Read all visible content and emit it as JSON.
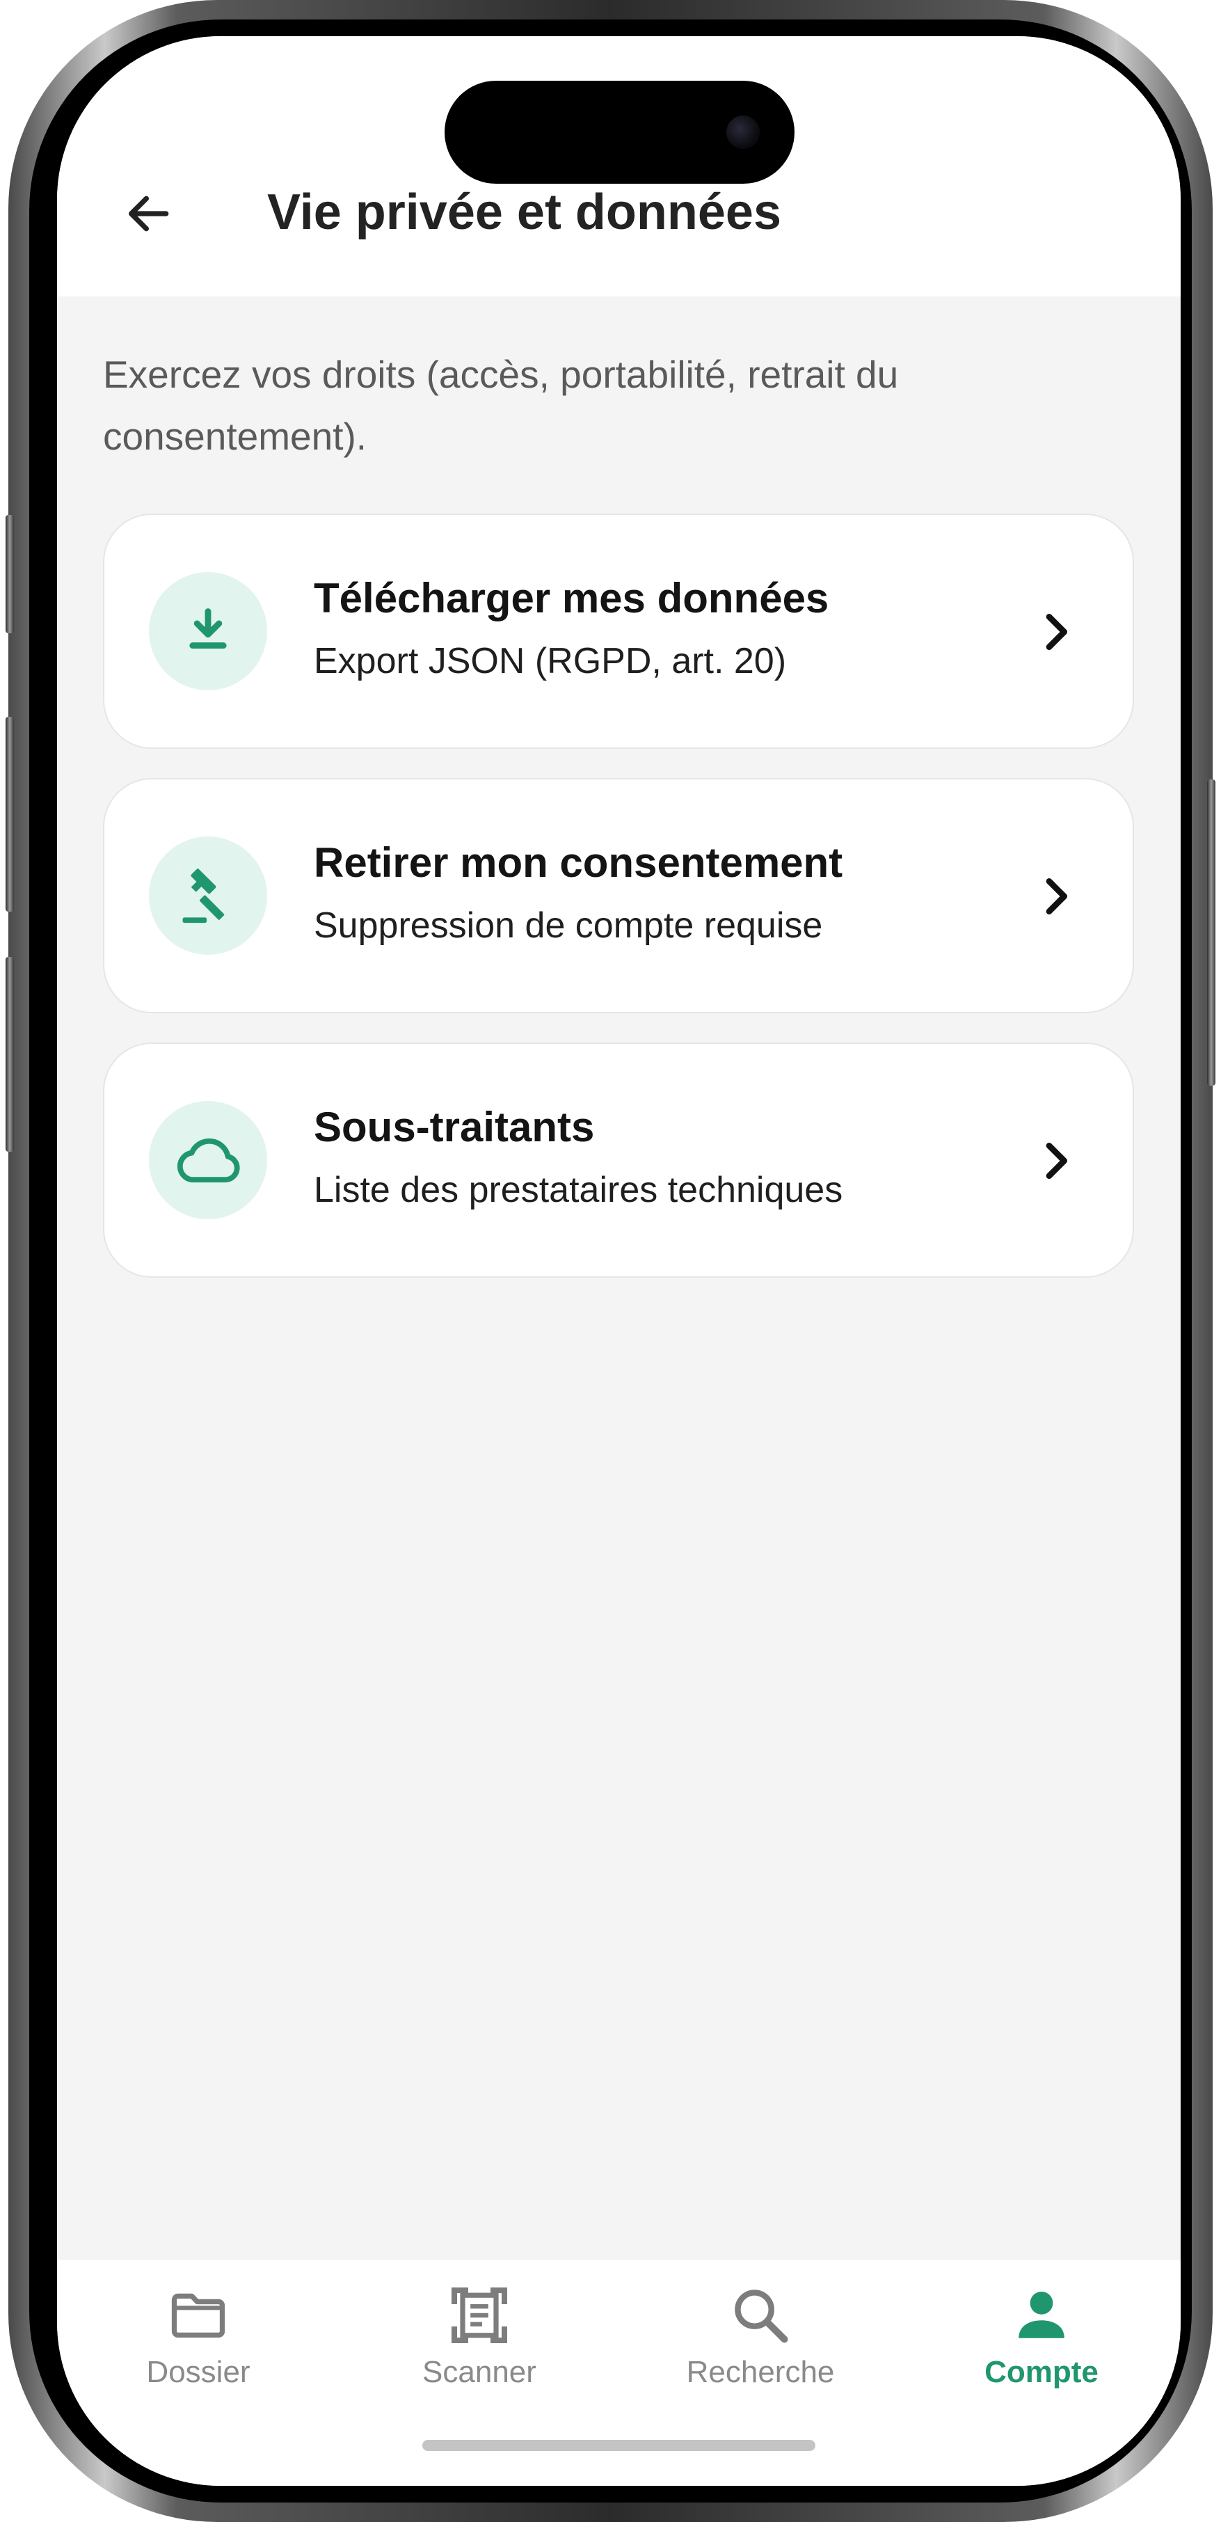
{
  "header": {
    "title": "Vie privée et données",
    "back_icon": "arrow-left-icon"
  },
  "intro": "Exercez vos droits (accès, portabilité, retrait du consentement).",
  "cards": [
    {
      "icon": "download-icon",
      "title": "Télécharger mes données",
      "subtitle": "Export JSON (RGPD, art. 20)"
    },
    {
      "icon": "gavel-icon",
      "title": "Retirer mon consentement",
      "subtitle": "Suppression de compte requise"
    },
    {
      "icon": "cloud-icon",
      "title": "Sous-traitants",
      "subtitle": "Liste des prestataires techniques"
    }
  ],
  "bottom_nav": {
    "items": [
      {
        "label": "Dossier",
        "icon": "folder-icon",
        "active": false
      },
      {
        "label": "Scanner",
        "icon": "document-scanner-icon",
        "active": false
      },
      {
        "label": "Recherche",
        "icon": "search-icon",
        "active": false
      },
      {
        "label": "Compte",
        "icon": "person-icon",
        "active": true
      }
    ]
  },
  "colors": {
    "accent": "#20966f",
    "icon_bg": "#e2f4ee",
    "background": "#f4f4f4",
    "nav_inactive": "#8a8a8a"
  }
}
